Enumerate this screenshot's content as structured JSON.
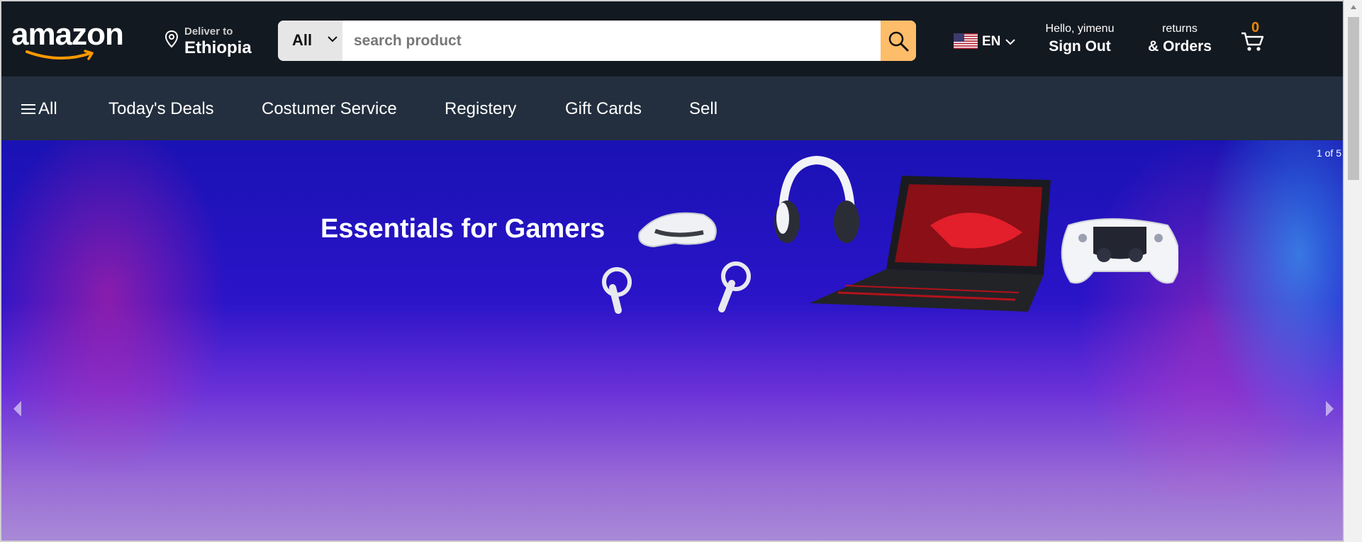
{
  "header": {
    "logo_text": "amazon",
    "deliver": {
      "label": "Deliver to",
      "location": "Ethiopia"
    },
    "search": {
      "category": "All",
      "placeholder": "search product"
    },
    "language": {
      "code": "EN"
    },
    "account": {
      "greeting": "Hello, yimenu",
      "action": "Sign Out"
    },
    "orders": {
      "line1": "returns",
      "line2": "& Orders"
    },
    "cart": {
      "count": "0"
    }
  },
  "nav": {
    "all_label": "All",
    "items": [
      "Today's Deals",
      "Costumer Service",
      "Registery",
      "Gift Cards",
      "Sell"
    ]
  },
  "hero": {
    "counter": "1 of 5",
    "headline": "Essentials for Gamers"
  },
  "colors": {
    "header_bg": "#131921",
    "nav_bg": "#232f3e",
    "search_button": "#febd69",
    "cart_count": "#f08804",
    "logo_smile": "#ff9900"
  },
  "icons": [
    "location-pin-icon",
    "chevron-down-icon",
    "search-icon",
    "us-flag-icon",
    "cart-icon",
    "menu-icon",
    "chevron-left-icon",
    "chevron-right-icon"
  ]
}
